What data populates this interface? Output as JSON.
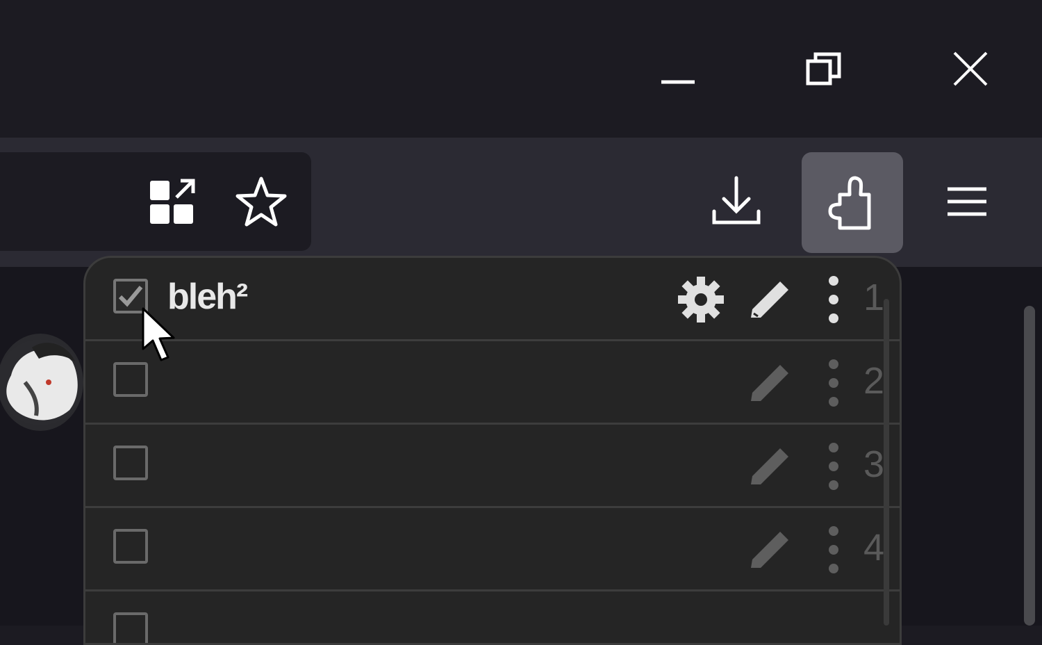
{
  "window_controls": {
    "minimize": "minimize-icon",
    "restore": "restore-icon",
    "close": "close-icon"
  },
  "toolbar": {
    "icons": [
      "tab-grid-icon",
      "bookmark-star-icon",
      "download-icon",
      "extensions-puzzle-icon",
      "menu-hamburger-icon"
    ]
  },
  "colors": {
    "titlebar": "#1c1b22",
    "toolbar": "#2b2a33",
    "popup_bg": "#252525",
    "active_button": "#5b5a63"
  },
  "popup": {
    "rows": [
      {
        "checked": true,
        "title": "bleh²",
        "number": "1"
      },
      {
        "checked": false,
        "title": "",
        "number": "2"
      },
      {
        "checked": false,
        "title": "",
        "number": "3"
      },
      {
        "checked": false,
        "title": "",
        "number": "4"
      }
    ]
  }
}
